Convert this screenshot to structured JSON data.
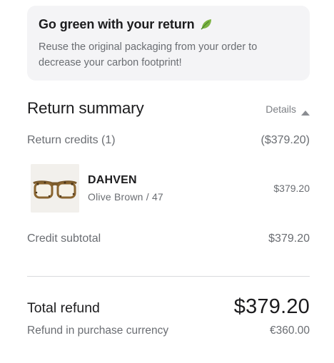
{
  "banner": {
    "title": "Go green with your return",
    "icon": "leaf-icon",
    "description": "Reuse the original packaging from your order to decrease your carbon footprint!"
  },
  "summary": {
    "title": "Return summary",
    "details_label": "Details",
    "return_credits_label": "Return credits (1)",
    "return_credits_value": "($379.20)"
  },
  "items": [
    {
      "name": "DAHVEN",
      "variant": "Olive Brown / 47",
      "price": "$379.20"
    }
  ],
  "credit_subtotal": {
    "label": "Credit subtotal",
    "value": "$379.20"
  },
  "total_refund": {
    "label": "Total refund",
    "value": "$379.20",
    "currency_label": "Refund in purchase currency",
    "currency_value": "€360.00"
  },
  "colors": {
    "banner_bg": "#f4f4f6",
    "muted_text": "#6a6d72",
    "primary_text": "#1c1c1e",
    "leaf_green": "#6aa84f"
  }
}
